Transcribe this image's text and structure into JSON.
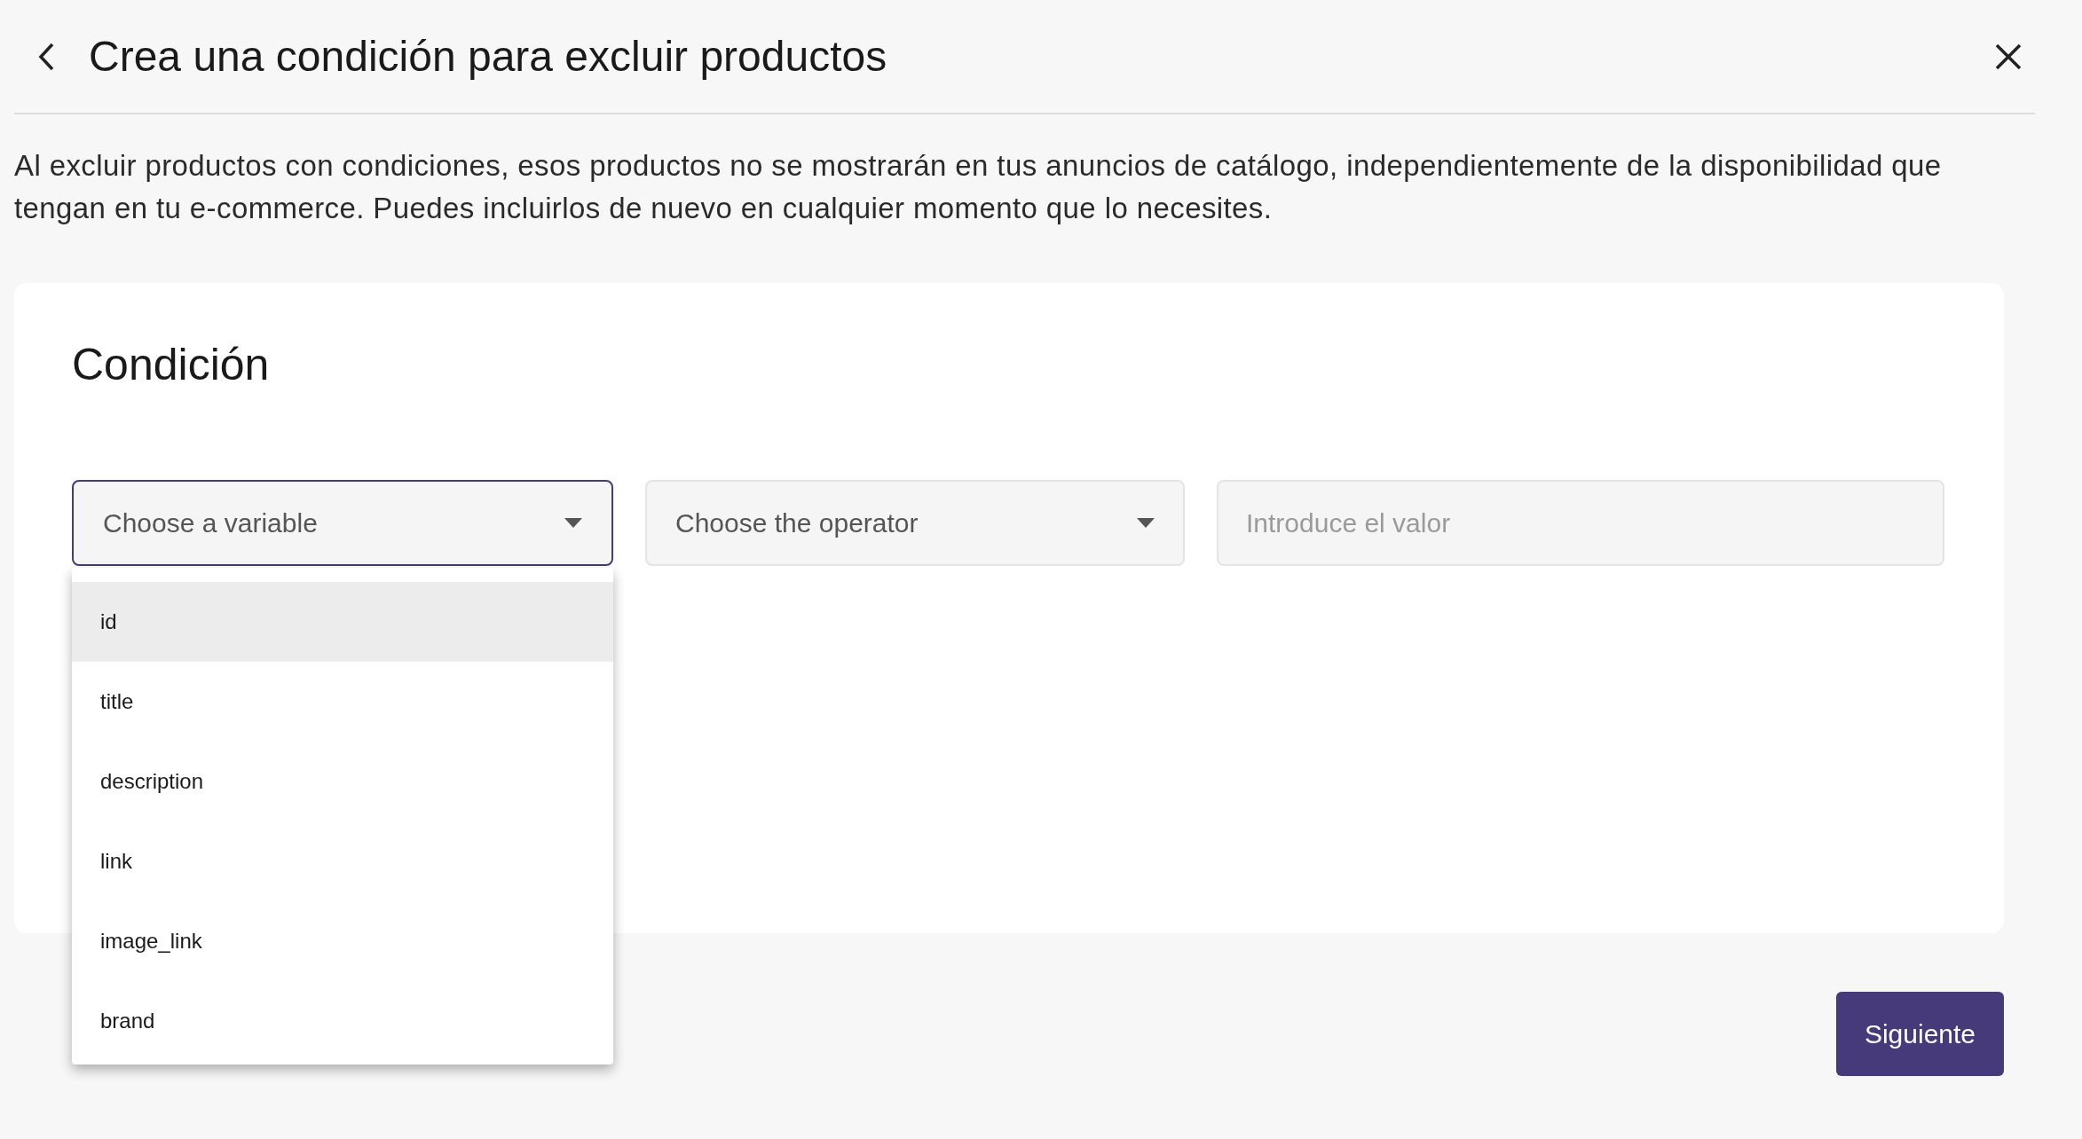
{
  "header": {
    "title": "Crea una condición para excluir productos"
  },
  "description": "Al excluir productos con condiciones, esos productos no se mostrarán en tus anuncios de catálogo, independientemente de la disponibilidad que tengan en tu e-commerce. Puedes incluirlos de nuevo en cualquier momento que lo necesites.",
  "card": {
    "title": "Condición",
    "variable_select": {
      "placeholder": "Choose a variable",
      "focused": true,
      "expanded": true
    },
    "operator_select": {
      "placeholder": "Choose the operator",
      "focused": false
    },
    "value_field": {
      "placeholder": "Introduce el valor"
    }
  },
  "dropdown_options": [
    {
      "label": "id",
      "highlighted": true
    },
    {
      "label": "title",
      "highlighted": false
    },
    {
      "label": "description",
      "highlighted": false
    },
    {
      "label": "link",
      "highlighted": false
    },
    {
      "label": "image_link",
      "highlighted": false
    },
    {
      "label": "brand",
      "highlighted": false
    }
  ],
  "next_button": "Siguiente"
}
